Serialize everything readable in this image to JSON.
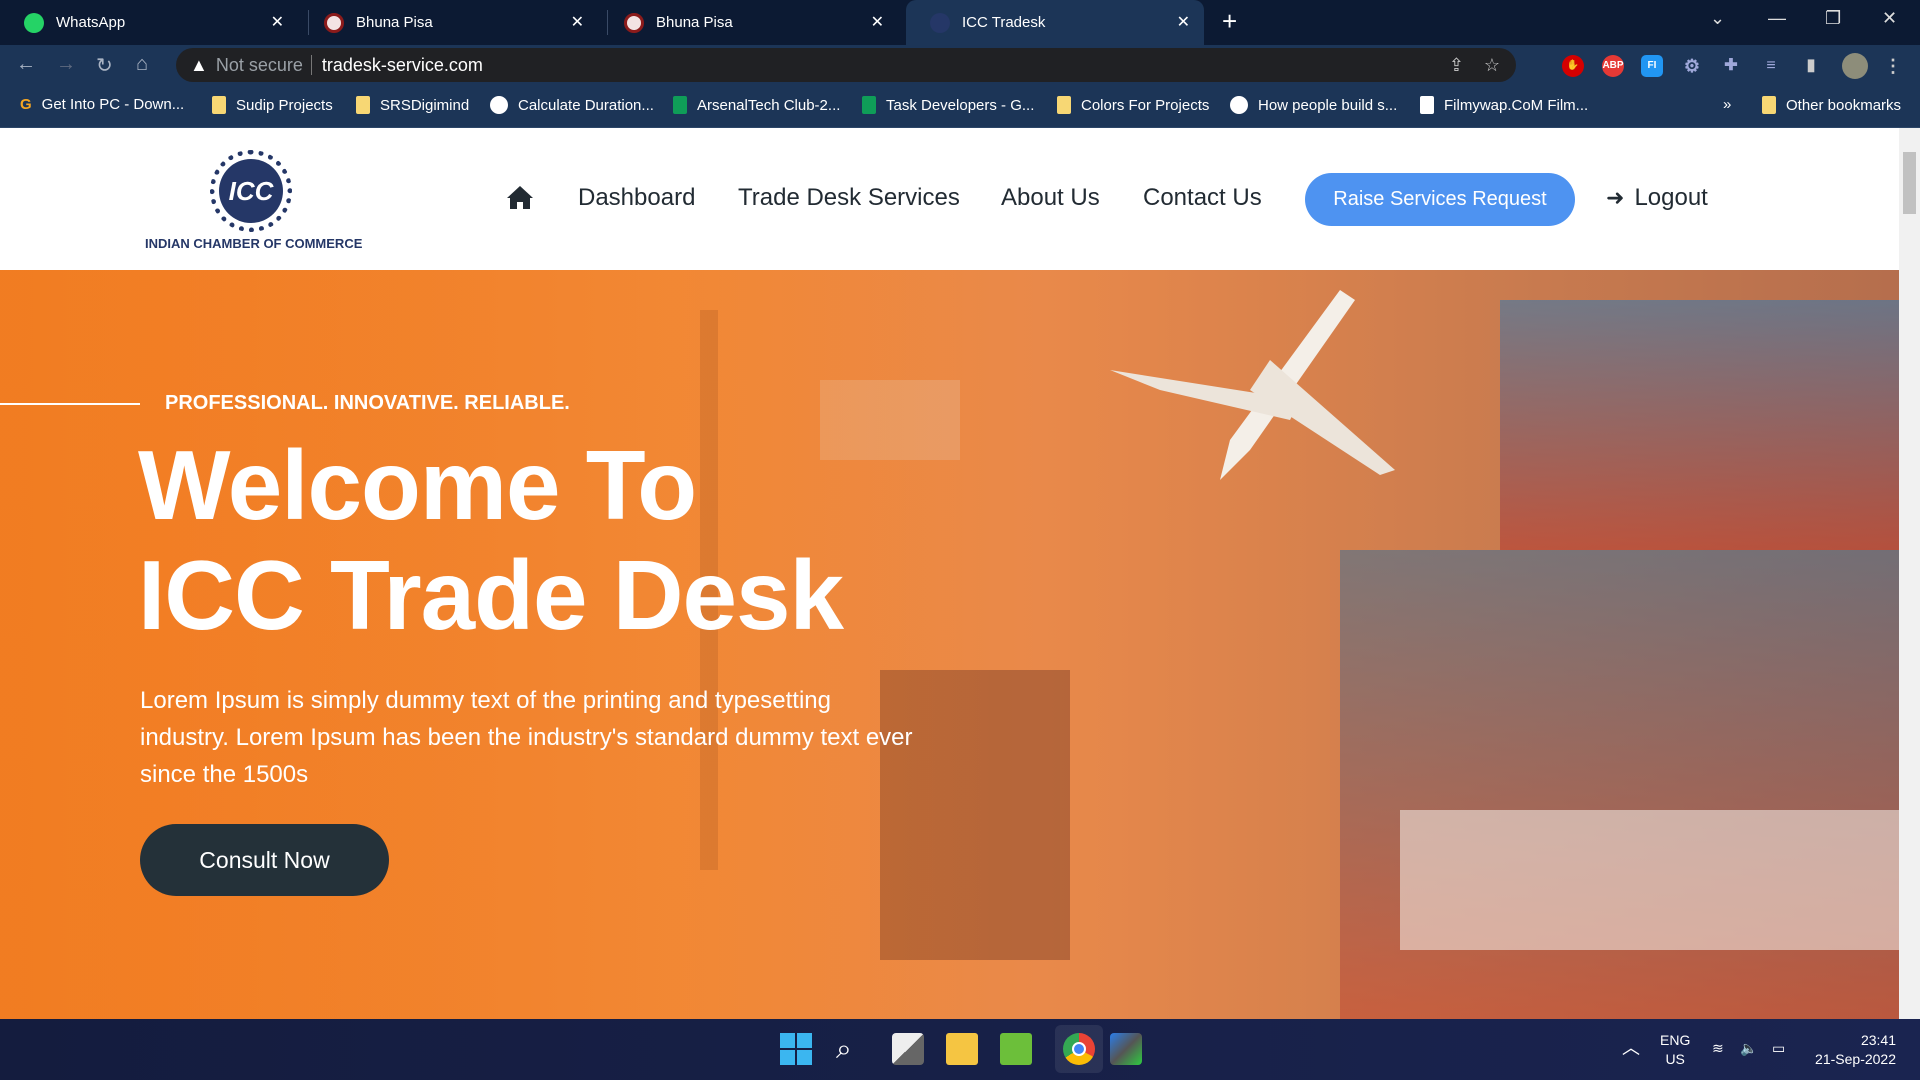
{
  "browser": {
    "tabs": [
      {
        "title": "WhatsApp",
        "icon": "whatsapp-icon"
      },
      {
        "title": "Bhuna Pisa",
        "icon": "bhuna-pisa-icon"
      },
      {
        "title": "Bhuna Pisa",
        "icon": "bhuna-pisa-icon"
      },
      {
        "title": "ICC Tradesk",
        "icon": "icc-icon",
        "active": true
      }
    ],
    "security": "Not secure",
    "url": "tradesk-service.com",
    "bookmarks": [
      "Get Into PC - Down...",
      "Sudip Projects",
      "SRSDigimind",
      "Calculate Duration...",
      "ArsenalTech Club-2...",
      "Task Developers - G...",
      "Colors For Projects",
      "How people build s...",
      "Filmywap.CoM Film..."
    ],
    "other_bookmarks": "Other bookmarks",
    "extensions": [
      "adblock-hand",
      "ABP",
      "FI"
    ]
  },
  "site": {
    "logo_text": "ICC",
    "org_name": "INDIAN CHAMBER OF COMMERCE",
    "nav": [
      "Dashboard",
      "Trade Desk Services",
      "About Us",
      "Contact Us"
    ],
    "cta": "Raise Services Request",
    "logout": "Logout",
    "accent": "#4e93f1",
    "hero": {
      "tagline": "PROFESSIONAL. INNOVATIVE. RELIABLE.",
      "title_line1": "Welcome To",
      "title_line2": "ICC Trade Desk",
      "description": "Lorem Ipsum is simply dummy text of the printing and typesetting industry. Lorem Ipsum has been the industry's standard dummy text ever since the 1500s",
      "button": "Consult Now"
    }
  },
  "taskbar": {
    "lang1": "ENG",
    "lang2": "US",
    "time": "23:41",
    "date": "21-Sep-2022"
  }
}
